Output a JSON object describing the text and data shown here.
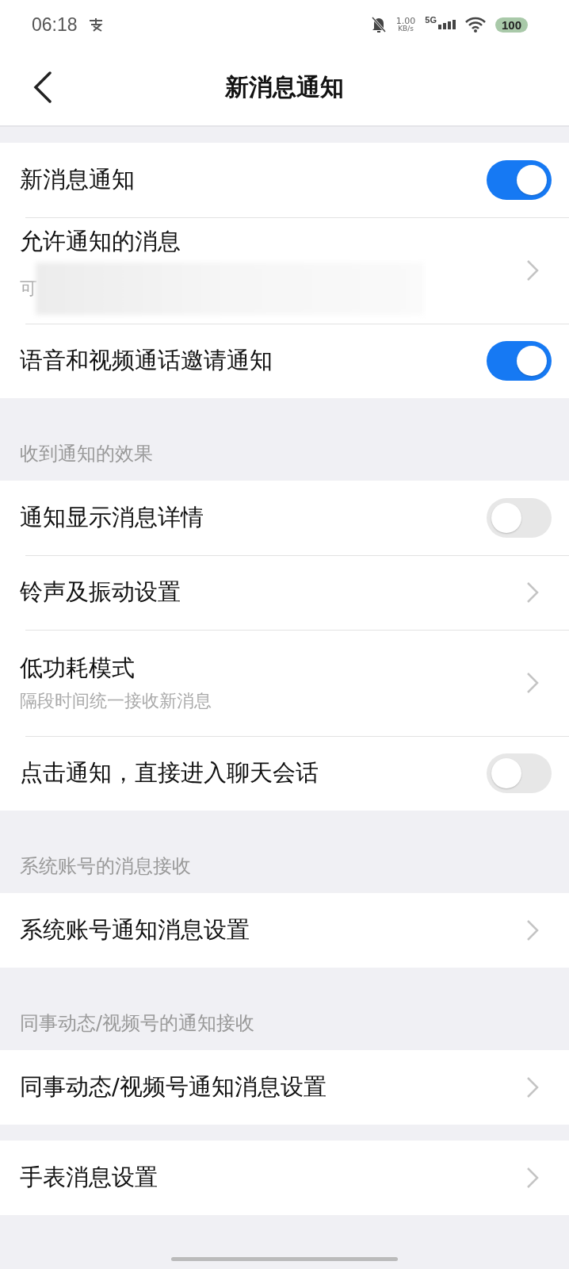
{
  "status_bar": {
    "time": "06:18",
    "speed_value": "1.00",
    "speed_unit": "KB/s",
    "network": "5G",
    "battery": "100"
  },
  "header": {
    "title": "新消息通知"
  },
  "groups": [
    {
      "rows": [
        {
          "kind": "toggle",
          "label": "新消息通知",
          "on": true
        },
        {
          "kind": "link",
          "label": "允许通知的消息",
          "subtitle": "可",
          "redacted": true
        },
        {
          "kind": "toggle",
          "label": "语音和视频通话邀请通知",
          "on": true
        }
      ]
    },
    {
      "header": "收到通知的效果",
      "rows": [
        {
          "kind": "toggle",
          "label": "通知显示消息详情",
          "on": false
        },
        {
          "kind": "link",
          "label": "铃声及振动设置"
        },
        {
          "kind": "link",
          "label": "低功耗模式",
          "subtitle": "隔段时间统一接收新消息"
        },
        {
          "kind": "toggle",
          "label": "点击通知，直接进入聊天会话",
          "on": false
        }
      ]
    },
    {
      "header": "系统账号的消息接收",
      "rows": [
        {
          "kind": "link",
          "label": "系统账号通知消息设置"
        }
      ]
    },
    {
      "header": "同事动态/视频号的通知接收",
      "rows": [
        {
          "kind": "link",
          "label": "同事动态/视频号通知消息设置"
        }
      ]
    },
    {
      "rows": [
        {
          "kind": "link",
          "label": "手表消息设置"
        }
      ]
    }
  ]
}
